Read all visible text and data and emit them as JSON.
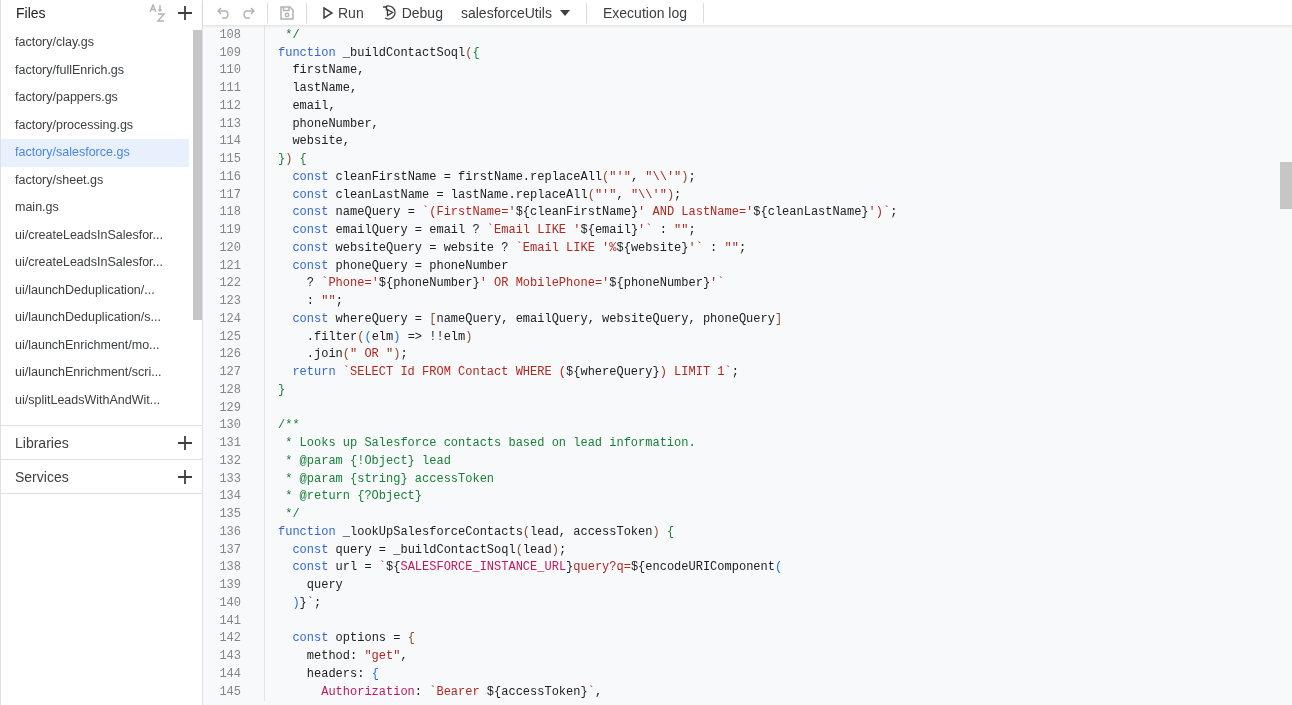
{
  "sidebar": {
    "title": "Files",
    "files": [
      {
        "name": "factory/clay.gs",
        "selected": false
      },
      {
        "name": "factory/fullEnrich.gs",
        "selected": false
      },
      {
        "name": "factory/pappers.gs",
        "selected": false
      },
      {
        "name": "factory/processing.gs",
        "selected": false
      },
      {
        "name": "factory/salesforce.gs",
        "selected": true
      },
      {
        "name": "factory/sheet.gs",
        "selected": false
      },
      {
        "name": "main.gs",
        "selected": false
      },
      {
        "name": "ui/createLeadsInSalesfor...",
        "selected": false
      },
      {
        "name": "ui/createLeadsInSalesfor...",
        "selected": false
      },
      {
        "name": "ui/launchDeduplication/...",
        "selected": false
      },
      {
        "name": "ui/launchDeduplication/s...",
        "selected": false
      },
      {
        "name": "ui/launchEnrichment/mo...",
        "selected": false
      },
      {
        "name": "ui/launchEnrichment/scri...",
        "selected": false
      },
      {
        "name": "ui/splitLeadsWithAndWit...",
        "selected": false
      }
    ],
    "sections": [
      {
        "label": "Libraries"
      },
      {
        "label": "Services"
      }
    ]
  },
  "toolbar": {
    "run": "Run",
    "debug": "Debug",
    "function_select": "salesforceUtils",
    "execution_log": "Execution log"
  },
  "editor": {
    "lines": [
      {
        "number": "108",
        "tokens": [
          {
            "kind": "comment",
            "text": " */"
          }
        ]
      },
      {
        "number": "109",
        "tokens": [
          {
            "kind": "keyword",
            "text": "function"
          },
          {
            "kind": "plain",
            "text": " _buildContactSoql"
          },
          {
            "kind": "bracket",
            "text": "("
          },
          {
            "kind": "brace",
            "text": "{"
          }
        ]
      },
      {
        "number": "110",
        "tokens": [
          {
            "kind": "plain",
            "text": "  firstName,"
          }
        ]
      },
      {
        "number": "111",
        "tokens": [
          {
            "kind": "plain",
            "text": "  lastName,"
          }
        ]
      },
      {
        "number": "112",
        "tokens": [
          {
            "kind": "plain",
            "text": "  email,"
          }
        ]
      },
      {
        "number": "113",
        "tokens": [
          {
            "kind": "plain",
            "text": "  phoneNumber,"
          }
        ]
      },
      {
        "number": "114",
        "tokens": [
          {
            "kind": "plain",
            "text": "  website,"
          }
        ]
      },
      {
        "number": "115",
        "tokens": [
          {
            "kind": "brace",
            "text": "}"
          },
          {
            "kind": "bracket",
            "text": ") "
          },
          {
            "kind": "brace",
            "text": "{"
          }
        ]
      },
      {
        "number": "116",
        "tokens": [
          {
            "kind": "keyword",
            "text": "  const"
          },
          {
            "kind": "plain",
            "text": " cleanFirstName = firstName.replaceAll"
          },
          {
            "kind": "bracket",
            "text": "("
          },
          {
            "kind": "string",
            "text": "\"'\""
          },
          {
            "kind": "plain",
            "text": ", "
          },
          {
            "kind": "string",
            "text": "\"\\\\'\""
          },
          {
            "kind": "bracket",
            "text": ")"
          },
          {
            "kind": "plain",
            "text": ";"
          }
        ]
      },
      {
        "number": "117",
        "tokens": [
          {
            "kind": "keyword",
            "text": "  const"
          },
          {
            "kind": "plain",
            "text": " cleanLastName = lastName.replaceAll"
          },
          {
            "kind": "bracket",
            "text": "("
          },
          {
            "kind": "string",
            "text": "\"'\""
          },
          {
            "kind": "plain",
            "text": ", "
          },
          {
            "kind": "string",
            "text": "\"\\\\'\""
          },
          {
            "kind": "bracket",
            "text": ")"
          },
          {
            "kind": "plain",
            "text": ";"
          }
        ]
      },
      {
        "number": "118",
        "tokens": [
          {
            "kind": "keyword",
            "text": "  const"
          },
          {
            "kind": "plain",
            "text": " nameQuery = "
          },
          {
            "kind": "string",
            "text": "`(FirstName='"
          },
          {
            "kind": "plain",
            "text": "${cleanFirstName}"
          },
          {
            "kind": "string",
            "text": "' AND LastName='"
          },
          {
            "kind": "plain",
            "text": "${cleanLastName}"
          },
          {
            "kind": "string",
            "text": "')`"
          },
          {
            "kind": "plain",
            "text": ";"
          }
        ]
      },
      {
        "number": "119",
        "tokens": [
          {
            "kind": "keyword",
            "text": "  const"
          },
          {
            "kind": "plain",
            "text": " emailQuery = email ? "
          },
          {
            "kind": "string",
            "text": "`Email LIKE '"
          },
          {
            "kind": "plain",
            "text": "${email}"
          },
          {
            "kind": "string",
            "text": "'`"
          },
          {
            "kind": "plain",
            "text": " : "
          },
          {
            "kind": "string",
            "text": "\"\""
          },
          {
            "kind": "plain",
            "text": ";"
          }
        ]
      },
      {
        "number": "120",
        "tokens": [
          {
            "kind": "keyword",
            "text": "  const"
          },
          {
            "kind": "plain",
            "text": " websiteQuery = website ? "
          },
          {
            "kind": "string",
            "text": "`Email LIKE '%"
          },
          {
            "kind": "plain",
            "text": "${website}"
          },
          {
            "kind": "string",
            "text": "'`"
          },
          {
            "kind": "plain",
            "text": " : "
          },
          {
            "kind": "string",
            "text": "\"\""
          },
          {
            "kind": "plain",
            "text": ";"
          }
        ]
      },
      {
        "number": "121",
        "tokens": [
          {
            "kind": "keyword",
            "text": "  const"
          },
          {
            "kind": "plain",
            "text": " phoneQuery = phoneNumber"
          }
        ]
      },
      {
        "number": "122",
        "tokens": [
          {
            "kind": "plain",
            "text": "    ? "
          },
          {
            "kind": "string",
            "text": "`Phone='"
          },
          {
            "kind": "plain",
            "text": "${phoneNumber}"
          },
          {
            "kind": "string",
            "text": "' OR MobilePhone='"
          },
          {
            "kind": "plain",
            "text": "${phoneNumber}"
          },
          {
            "kind": "string",
            "text": "'`"
          }
        ]
      },
      {
        "number": "123",
        "tokens": [
          {
            "kind": "plain",
            "text": "    : "
          },
          {
            "kind": "string",
            "text": "\"\""
          },
          {
            "kind": "plain",
            "text": ";"
          }
        ]
      },
      {
        "number": "124",
        "tokens": [
          {
            "kind": "keyword",
            "text": "  const"
          },
          {
            "kind": "plain",
            "text": " whereQuery = "
          },
          {
            "kind": "bracket",
            "text": "["
          },
          {
            "kind": "plain",
            "text": "nameQuery, emailQuery, websiteQuery, phoneQuery"
          },
          {
            "kind": "bracket",
            "text": "]"
          }
        ]
      },
      {
        "number": "125",
        "tokens": [
          {
            "kind": "plain",
            "text": "    .filter"
          },
          {
            "kind": "bracket",
            "text": "("
          },
          {
            "kind": "paren",
            "text": "("
          },
          {
            "kind": "plain",
            "text": "elm"
          },
          {
            "kind": "paren",
            "text": ")"
          },
          {
            "kind": "plain",
            "text": " => !!elm"
          },
          {
            "kind": "bracket",
            "text": ")"
          }
        ]
      },
      {
        "number": "126",
        "tokens": [
          {
            "kind": "plain",
            "text": "    .join"
          },
          {
            "kind": "bracket",
            "text": "("
          },
          {
            "kind": "string",
            "text": "\" OR \""
          },
          {
            "kind": "bracket",
            "text": ")"
          },
          {
            "kind": "plain",
            "text": ";"
          }
        ]
      },
      {
        "number": "127",
        "tokens": [
          {
            "kind": "keyword",
            "text": "  return"
          },
          {
            "kind": "string",
            "text": " `SELECT Id FROM Contact WHERE ("
          },
          {
            "kind": "plain",
            "text": "${whereQuery}"
          },
          {
            "kind": "string",
            "text": ") LIMIT 1`"
          },
          {
            "kind": "plain",
            "text": ";"
          }
        ]
      },
      {
        "number": "128",
        "tokens": [
          {
            "kind": "brace",
            "text": "}"
          }
        ]
      },
      {
        "number": "129"
      },
      {
        "number": "130",
        "tokens": [
          {
            "kind": "comment",
            "text": "/**"
          }
        ]
      },
      {
        "number": "131",
        "tokens": [
          {
            "kind": "comment",
            "text": " * Looks up Salesforce contacts based on lead information."
          }
        ]
      },
      {
        "number": "132",
        "tokens": [
          {
            "kind": "comment",
            "text": " * @param {!Object} lead"
          }
        ]
      },
      {
        "number": "133",
        "tokens": [
          {
            "kind": "comment",
            "text": " * @param {string} accessToken"
          }
        ]
      },
      {
        "number": "134",
        "tokens": [
          {
            "kind": "comment",
            "text": " * @return {?Object}"
          }
        ]
      },
      {
        "number": "135",
        "tokens": [
          {
            "kind": "comment",
            "text": " */"
          }
        ]
      },
      {
        "number": "136",
        "tokens": [
          {
            "kind": "keyword",
            "text": "function"
          },
          {
            "kind": "plain",
            "text": " _lookUpSalesforceContacts"
          },
          {
            "kind": "bracket",
            "text": "("
          },
          {
            "kind": "plain",
            "text": "lead, accessToken"
          },
          {
            "kind": "bracket",
            "text": ") "
          },
          {
            "kind": "brace",
            "text": "{"
          }
        ]
      },
      {
        "number": "137",
        "tokens": [
          {
            "kind": "keyword",
            "text": "  const"
          },
          {
            "kind": "plain",
            "text": " query = _buildContactSoql"
          },
          {
            "kind": "bracket",
            "text": "("
          },
          {
            "kind": "plain",
            "text": "lead"
          },
          {
            "kind": "bracket",
            "text": ")"
          },
          {
            "kind": "plain",
            "text": ";"
          }
        ]
      },
      {
        "number": "138",
        "tokens": [
          {
            "kind": "keyword",
            "text": "  const"
          },
          {
            "kind": "plain",
            "text": " url = "
          },
          {
            "kind": "string",
            "text": "`"
          },
          {
            "kind": "plain",
            "text": "${"
          },
          {
            "kind": "property",
            "text": "SALESFORCE_INSTANCE_URL"
          },
          {
            "kind": "plain",
            "text": "}"
          },
          {
            "kind": "string",
            "text": "query?q="
          },
          {
            "kind": "plain",
            "text": "${encodeURIComponent"
          },
          {
            "kind": "paren",
            "text": "("
          }
        ]
      },
      {
        "number": "139",
        "tokens": [
          {
            "kind": "plain",
            "text": "    query"
          }
        ]
      },
      {
        "number": "140",
        "tokens": [
          {
            "kind": "paren",
            "text": "  )"
          },
          {
            "kind": "plain",
            "text": "}"
          },
          {
            "kind": "string",
            "text": "`"
          },
          {
            "kind": "plain",
            "text": ";"
          }
        ]
      },
      {
        "number": "141"
      },
      {
        "number": "142",
        "tokens": [
          {
            "kind": "keyword",
            "text": "  const"
          },
          {
            "kind": "plain",
            "text": " options = "
          },
          {
            "kind": "bracket",
            "text": "{"
          }
        ]
      },
      {
        "number": "143",
        "tokens": [
          {
            "kind": "plain",
            "text": "    method: "
          },
          {
            "kind": "string",
            "text": "\"get\""
          },
          {
            "kind": "plain",
            "text": ","
          }
        ]
      },
      {
        "number": "144",
        "tokens": [
          {
            "kind": "plain",
            "text": "    headers: "
          },
          {
            "kind": "paren",
            "text": "{"
          }
        ]
      },
      {
        "number": "145",
        "tokens": [
          {
            "kind": "property",
            "text": "      Authorization"
          },
          {
            "kind": "plain",
            "text": ": "
          },
          {
            "kind": "string",
            "text": "`Bearer "
          },
          {
            "kind": "plain",
            "text": "${accessToken}"
          },
          {
            "kind": "string",
            "text": "`"
          },
          {
            "kind": "plain",
            "text": ","
          }
        ]
      }
    ]
  }
}
